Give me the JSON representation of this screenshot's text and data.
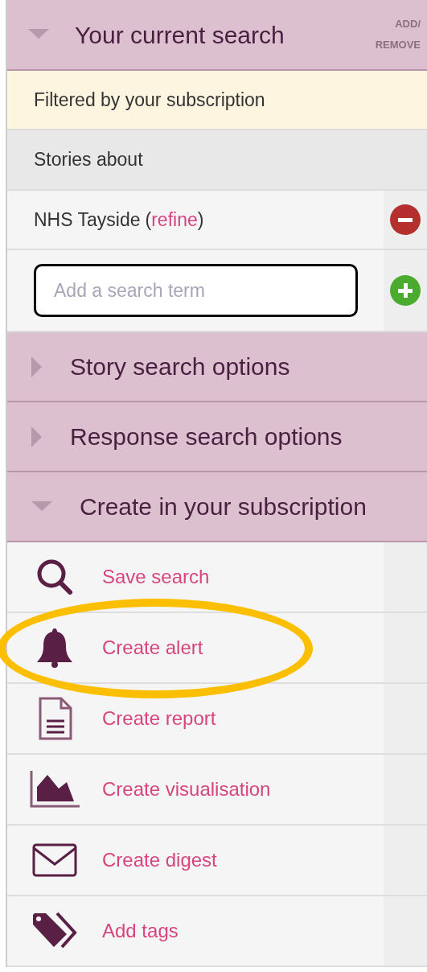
{
  "current_search": {
    "title": "Your current search",
    "expanded": true,
    "add_remove_label": "ADD/ REMOVE",
    "filter_note": "Filtered by your subscription",
    "stories_label": "Stories about",
    "terms": [
      {
        "term": "NHS Tayside",
        "open": "(",
        "refine": "refine",
        "close": ")"
      }
    ],
    "input": {
      "placeholder": "Add a search term"
    }
  },
  "sections": [
    {
      "title": "Story search options",
      "expanded": false
    },
    {
      "title": "Response search options",
      "expanded": false
    },
    {
      "title": "Create in your subscription",
      "expanded": true
    }
  ],
  "actions": [
    {
      "kind": "search",
      "label": "Save search",
      "highlighted": false
    },
    {
      "kind": "bell",
      "label": "Create alert",
      "highlighted": true
    },
    {
      "kind": "document",
      "label": "Create report",
      "highlighted": false
    },
    {
      "kind": "chart",
      "label": "Create visualisation",
      "highlighted": false
    },
    {
      "kind": "envelope",
      "label": "Create digest",
      "highlighted": false
    },
    {
      "kind": "tags",
      "label": "Add tags",
      "highlighted": false
    }
  ]
}
